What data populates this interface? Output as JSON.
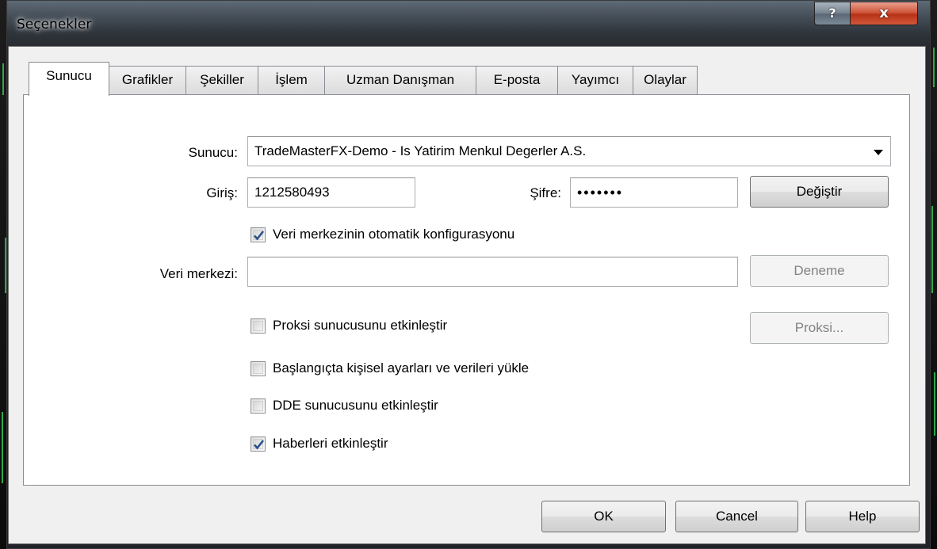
{
  "window": {
    "title": "Seçenekler",
    "help_button": "?",
    "close_button": "x"
  },
  "tabs": [
    {
      "label": "Sunucu",
      "active": true
    },
    {
      "label": "Grafikler"
    },
    {
      "label": "Şekiller"
    },
    {
      "label": "İşlem"
    },
    {
      "label": "Uzman Danışman"
    },
    {
      "label": "E-posta"
    },
    {
      "label": "Yayımcı"
    },
    {
      "label": "Olaylar"
    }
  ],
  "server": {
    "label": "Sunucu:",
    "value": "TradeMasterFX-Demo - Is Yatirim Menkul Degerler A.S."
  },
  "login": {
    "label": "Giriş:",
    "value": "1212580493"
  },
  "password": {
    "label": "Şifre:",
    "value": "•••••••"
  },
  "change_button": "Değiştir",
  "auto_config": {
    "label": "Veri merkezinin otomatik konfigurasyonu",
    "checked": true
  },
  "data_center": {
    "label": "Veri merkezi:",
    "value": ""
  },
  "test_button": "Deneme",
  "proxy_enable": {
    "label": "Proksi sunucusunu etkinleştir",
    "checked": false
  },
  "proxy_button": "Proksi...",
  "load_settings": {
    "label": "Başlangıçta kişisel ayarları ve verileri yükle",
    "checked": false
  },
  "dde_enable": {
    "label": "DDE sunucusunu etkinleştir",
    "checked": false
  },
  "news_enable": {
    "label": "Haberleri etkinleştir",
    "checked": true
  },
  "footer": {
    "ok": "OK",
    "cancel": "Cancel",
    "help": "Help"
  }
}
